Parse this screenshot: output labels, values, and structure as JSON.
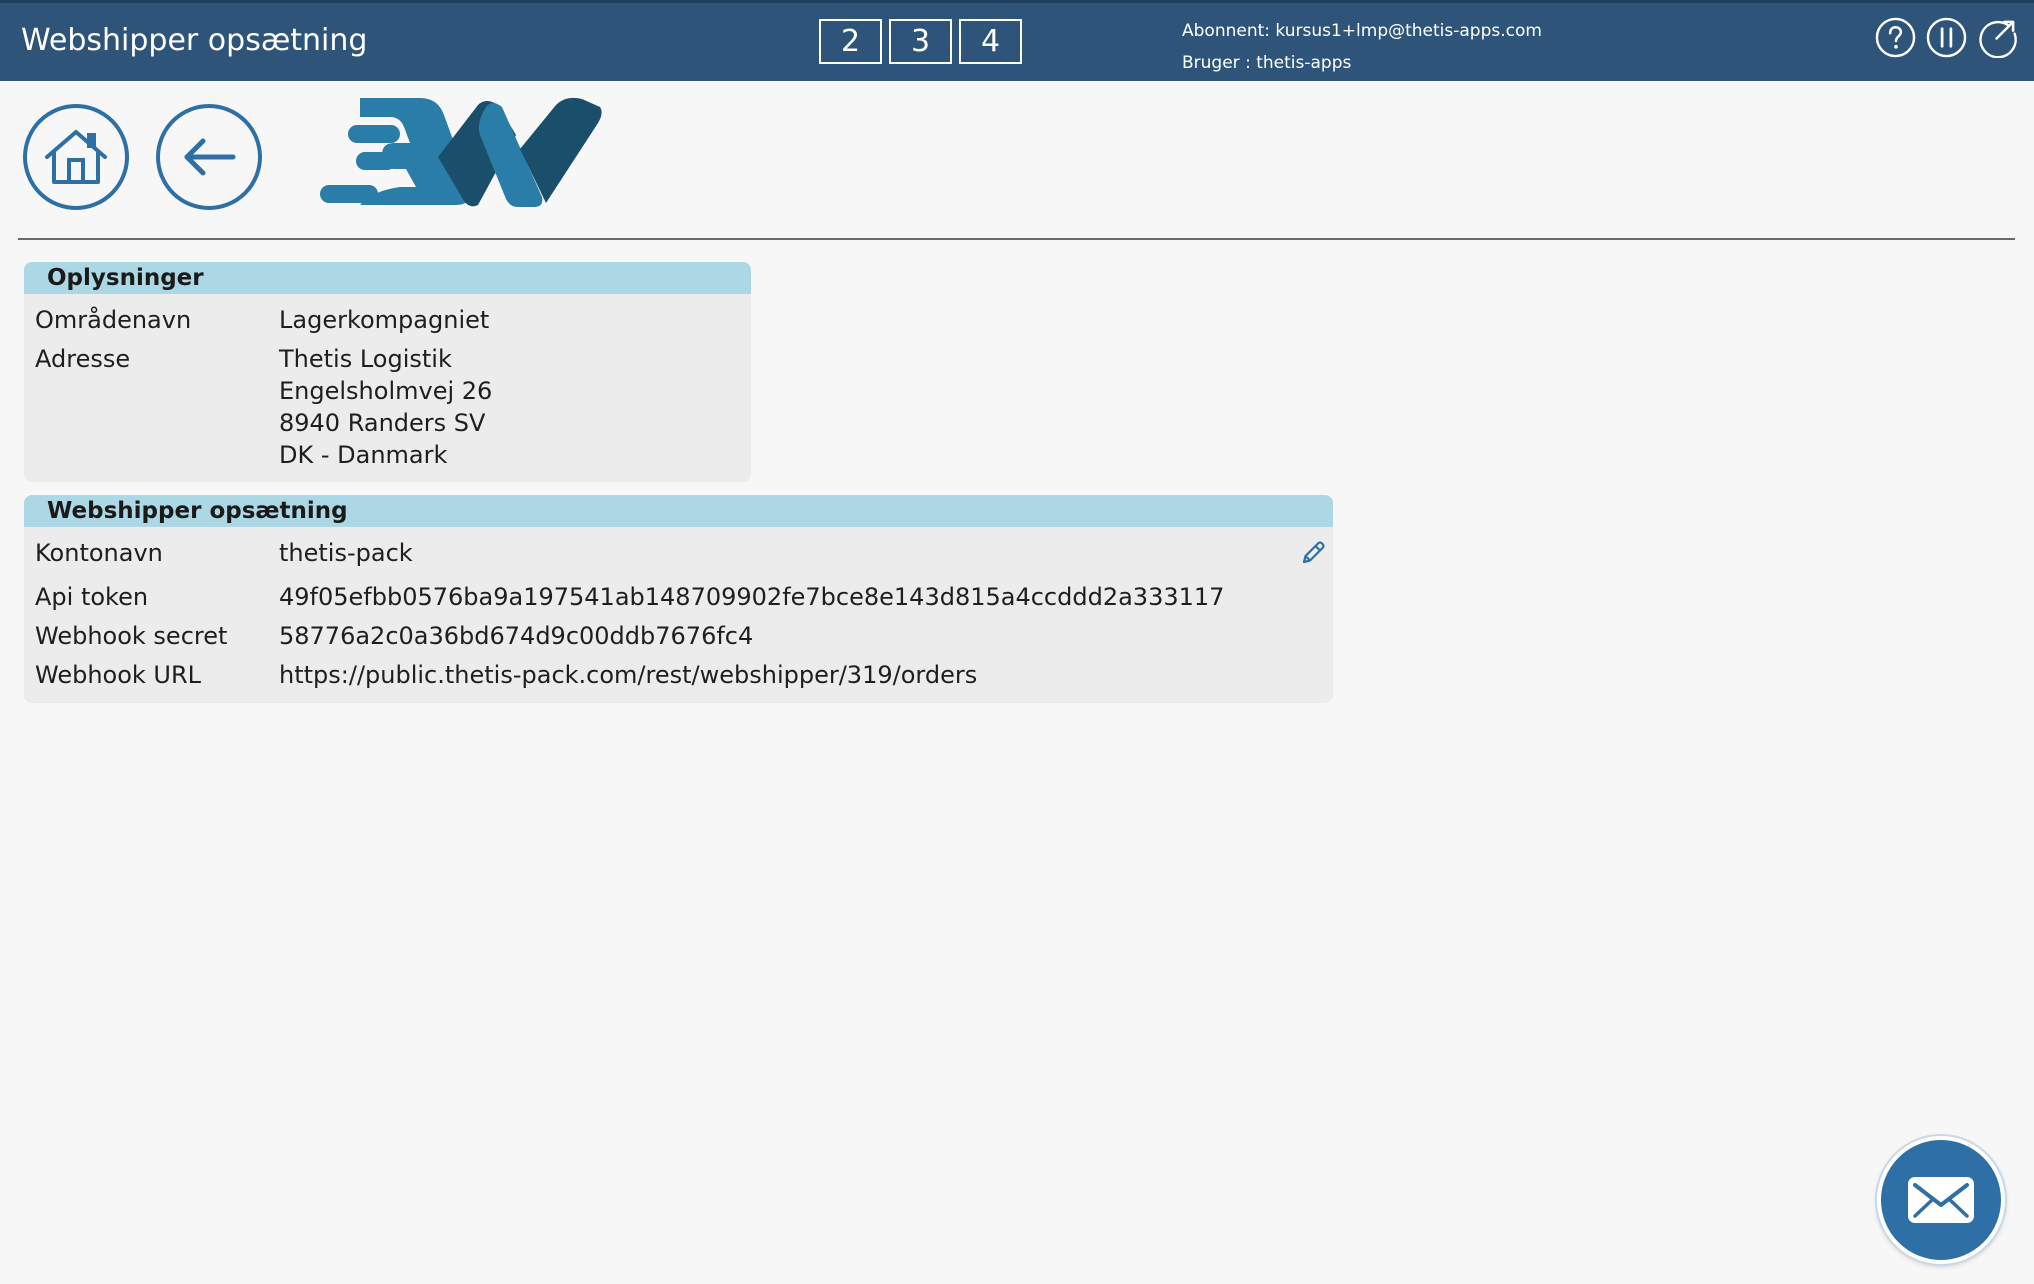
{
  "header": {
    "title": "Webshipper opsætning",
    "steps": [
      "2",
      "3",
      "4"
    ],
    "subscriber": "Abonnent: kursus1+lmp@thetis-apps.com",
    "user": "Bruger : thetis-apps",
    "icons": [
      "help-icon",
      "pause-icon",
      "open-external-icon"
    ]
  },
  "toolbar": {
    "home_icon": "home-icon",
    "back_icon": "arrow-left-icon",
    "logo": "webshipper-logo"
  },
  "info_panel": {
    "title": "Oplysninger",
    "area_label": "Områdenavn",
    "area_value": "Lagerkompagniet",
    "address_label": "Adresse",
    "address_lines": [
      "Thetis Logistik",
      "Engelsholmvej 26",
      "8940 Randers SV",
      "DK - Danmark"
    ]
  },
  "setup_panel": {
    "title": "Webshipper opsætning",
    "rows": [
      {
        "label": "Kontonavn",
        "value": "thetis-pack"
      },
      {
        "label": "Api token",
        "value": "49f05efbb0576ba9a197541ab148709902fe7bce8e143d815a4ccddd2a333117"
      },
      {
        "label": "Webhook secret",
        "value": "58776a2c0a36bd674d9c00ddb7676fc4"
      },
      {
        "label": "Webhook URL",
        "value": "https://public.thetis-pack.com/rest/webshipper/319/orders"
      }
    ],
    "edit_icon": "pencil-icon"
  },
  "floating": {
    "mail_icon": "envelope-icon"
  },
  "colors": {
    "header_bg": "#2e5479",
    "accent": "#2e6fa5",
    "panel_header": "#acd8e6",
    "panel_bg": "#ececec"
  }
}
